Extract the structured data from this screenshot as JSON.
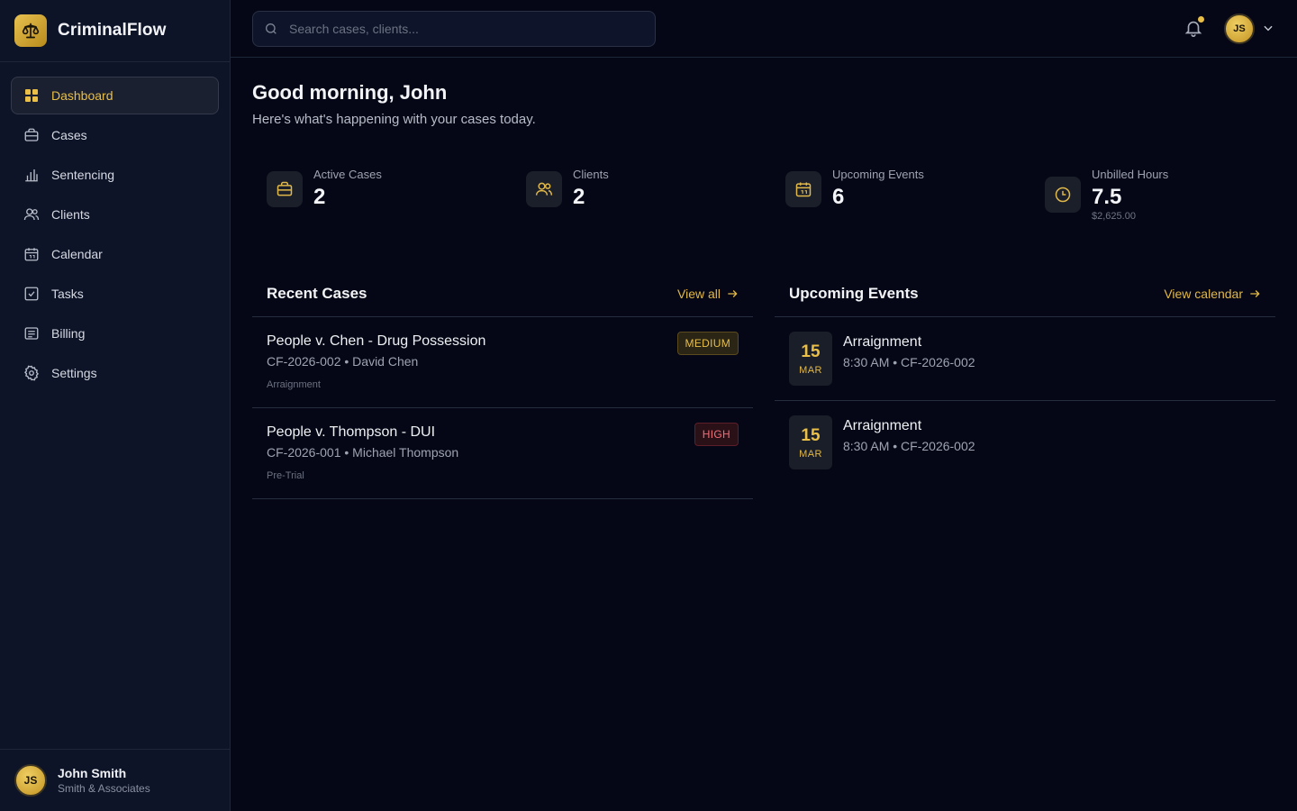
{
  "app": {
    "name": "CriminalFlow",
    "logo_icon": "scales-icon",
    "accent_color": "#e9bf47"
  },
  "sidebar": {
    "items": [
      {
        "label": "Dashboard",
        "icon": "grid-icon",
        "active": true
      },
      {
        "label": "Cases",
        "icon": "briefcase-icon"
      },
      {
        "label": "Sentencing",
        "icon": "bar-chart-icon"
      },
      {
        "label": "Clients",
        "icon": "users-icon"
      },
      {
        "label": "Calendar",
        "icon": "calendar-icon"
      },
      {
        "label": "Tasks",
        "icon": "checkbox-icon"
      },
      {
        "label": "Billing",
        "icon": "receipt-icon"
      },
      {
        "label": "Settings",
        "icon": "gear-icon"
      }
    ],
    "user": {
      "initials": "JS",
      "name": "John Smith",
      "firm": "Smith & Associates"
    }
  },
  "topbar": {
    "search_placeholder": "Search cases, clients...",
    "user_initials": "JS"
  },
  "main": {
    "greeting": "Good morning, John",
    "subtitle": "Here's what's happening with your cases today.",
    "stats": [
      {
        "label": "Active Cases",
        "value": "2",
        "icon": "briefcase-icon"
      },
      {
        "label": "Clients",
        "value": "2",
        "icon": "users-icon"
      },
      {
        "label": "Upcoming Events",
        "value": "6",
        "icon": "calendar-icon"
      },
      {
        "label": "Unbilled Hours",
        "value": "7.5",
        "sub": "$2,625.00",
        "icon": "clock-icon"
      }
    ],
    "recent_cases": {
      "title": "Recent Cases",
      "link": "View all",
      "items": [
        {
          "title": "People v. Chen - Drug Possession",
          "meta": "CF-2026-002 • David Chen",
          "stage": "Arraignment",
          "priority": "MEDIUM"
        },
        {
          "title": "People v. Thompson - DUI",
          "meta": "CF-2026-001 • Michael Thompson",
          "stage": "Pre-Trial",
          "priority": "HIGH"
        }
      ]
    },
    "upcoming_events": {
      "title": "Upcoming Events",
      "link": "View calendar",
      "items": [
        {
          "day": "15",
          "month": "MAR",
          "title": "Arraignment",
          "meta": "8:30 AM • CF-2026-002"
        },
        {
          "day": "15",
          "month": "MAR",
          "title": "Arraignment",
          "meta": "8:30 AM • CF-2026-002"
        }
      ]
    }
  }
}
